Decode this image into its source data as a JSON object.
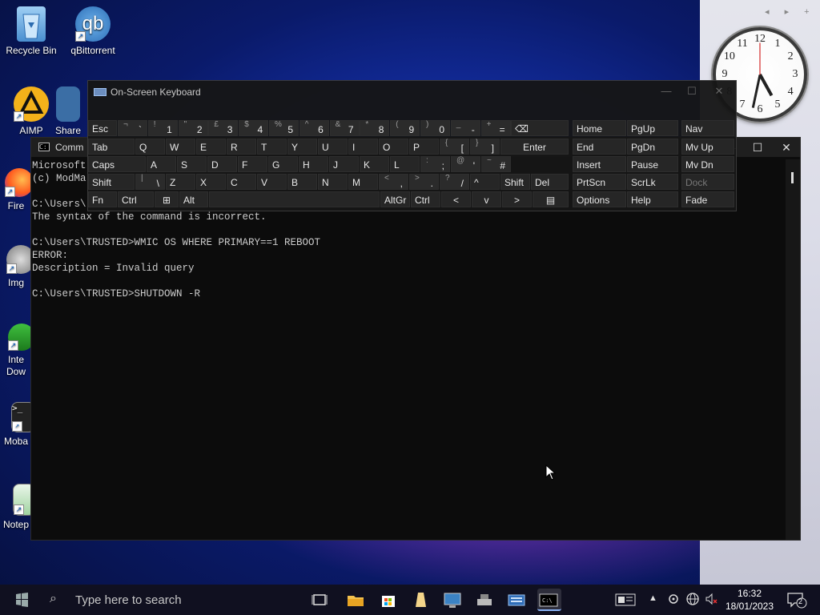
{
  "desktop": {
    "icons": [
      {
        "name": "recycle-bin",
        "label": "Recycle Bin"
      },
      {
        "name": "qbittorrent",
        "label": "qBittorrent",
        "glyph": "qb"
      },
      {
        "name": "aimp",
        "label": "AIMP"
      },
      {
        "name": "sharex",
        "label": "Share"
      },
      {
        "name": "firefox",
        "label": "Fire"
      },
      {
        "name": "imgburn",
        "label": "Img"
      },
      {
        "name": "idm",
        "label_line1": "Inte",
        "label_line2": "Dow"
      },
      {
        "name": "mobaxterm",
        "label": "Moba",
        "glyph": ">_"
      },
      {
        "name": "notepad",
        "label": "Notep"
      }
    ]
  },
  "clock_gadget": {
    "time": "16:32",
    "numbers": [
      "12",
      "1",
      "2",
      "3",
      "4",
      "5",
      "6",
      "7",
      "8",
      "9",
      "10",
      "11"
    ],
    "nav": "◂ ▸ +"
  },
  "console": {
    "title": "Comm",
    "lines": [
      "Microsoft",
      "(c) ModMa",
      "",
      "C:\\Users\\",
      "The syntax of the command is incorrect.",
      "",
      "C:\\Users\\TRUSTED>WMIC OS WHERE PRIMARY==1 REBOOT",
      "ERROR:",
      "Description = Invalid query",
      "",
      "C:\\Users\\TRUSTED>SHUTDOWN -R"
    ]
  },
  "osk": {
    "title": "On-Screen Keyboard",
    "row1": {
      "esc": "Esc",
      "digits": [
        {
          "shift": "¬",
          "low": "`"
        },
        {
          "shift": "!",
          "low": "1"
        },
        {
          "shift": "\"",
          "low": "2"
        },
        {
          "shift": "£",
          "low": "3"
        },
        {
          "shift": "$",
          "low": "4"
        },
        {
          "shift": "%",
          "low": "5"
        },
        {
          "shift": "^",
          "low": "6"
        },
        {
          "shift": "&",
          "low": "7"
        },
        {
          "shift": "*",
          "low": "8"
        },
        {
          "shift": "(",
          "low": "9"
        },
        {
          "shift": ")",
          "low": "0"
        },
        {
          "shift": "_",
          "low": "-"
        },
        {
          "shift": "+",
          "low": "="
        }
      ],
      "backspace": "⌫"
    },
    "row2": {
      "tab": "Tab",
      "letters": [
        "Q",
        "W",
        "E",
        "R",
        "T",
        "Y",
        "U",
        "I",
        "O",
        "P"
      ],
      "brackets": [
        {
          "shift": "{",
          "low": "["
        },
        {
          "shift": "}",
          "low": "]"
        }
      ],
      "enter": "Enter"
    },
    "row3": {
      "caps": "Caps",
      "letters": [
        "A",
        "S",
        "D",
        "F",
        "G",
        "H",
        "J",
        "K",
        "L"
      ],
      "syms": [
        {
          "shift": ":",
          "low": ";"
        },
        {
          "shift": "@",
          "low": "'"
        },
        {
          "shift": "~",
          "low": "#"
        }
      ]
    },
    "row4": {
      "shift": "Shift",
      "backslash": {
        "shift": "|",
        "low": "\\"
      },
      "letters": [
        "Z",
        "X",
        "C",
        "V",
        "B",
        "N",
        "M"
      ],
      "syms": [
        {
          "shift": "<",
          "low": ","
        },
        {
          "shift": ">",
          "low": "."
        },
        {
          "shift": "?",
          "low": "/"
        }
      ],
      "up": "^",
      "shift_r": "Shift",
      "del": "Del"
    },
    "row5": {
      "fn": "Fn",
      "ctrl": "Ctrl",
      "win": "⊞",
      "alt": "Alt",
      "altgr": "AltGr",
      "ctrl_r": "Ctrl",
      "left": "<",
      "down": "v",
      "right": ">",
      "menu": "▤"
    },
    "nav_keys": [
      [
        "Home",
        "PgUp",
        "Nav"
      ],
      [
        "End",
        "PgDn",
        "Mv Up"
      ],
      [
        "Insert",
        "Pause",
        "Mv Dn"
      ],
      [
        "PrtScn",
        "ScrLk",
        "Dock"
      ],
      [
        "Options",
        "Help",
        "Fade"
      ]
    ]
  },
  "taskbar": {
    "search_placeholder": "Type here to search",
    "time": "16:32",
    "date": "18/01/2023",
    "notifications": "2"
  }
}
